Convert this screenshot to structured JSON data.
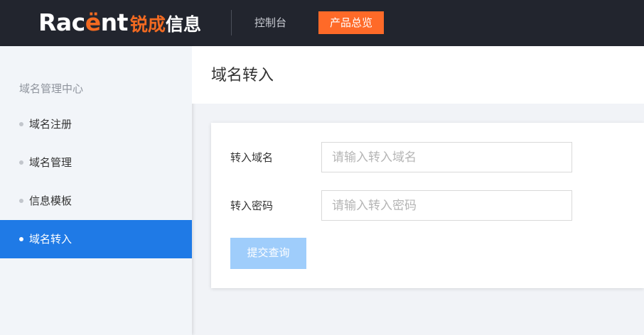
{
  "header": {
    "logo": {
      "latin_start": "Rac",
      "latin_accent": "ë",
      "latin_end": "nt",
      "cn_accent": "锐成",
      "cn_rest": "信息"
    },
    "nav": {
      "console": "控制台",
      "overview": "产品总览"
    }
  },
  "sidebar": {
    "title": "域名管理中心",
    "items": [
      {
        "label": "域名注册",
        "active": false
      },
      {
        "label": "域名管理",
        "active": false
      },
      {
        "label": "信息模板",
        "active": false
      },
      {
        "label": "域名转入",
        "active": true
      }
    ]
  },
  "main": {
    "title": "域名转入",
    "form": {
      "domain_label": "转入域名",
      "domain_placeholder": "请输入转入域名",
      "domain_value": "",
      "password_label": "转入密码",
      "password_placeholder": "请输入转入密码",
      "password_value": "",
      "submit_label": "提交查询"
    }
  },
  "colors": {
    "topbar_bg": "#22252e",
    "brand_orange": "#f26a21",
    "overview_button": "#ff6a28",
    "active_item": "#1f7ae6",
    "submit_button": "#9fcdfb"
  }
}
